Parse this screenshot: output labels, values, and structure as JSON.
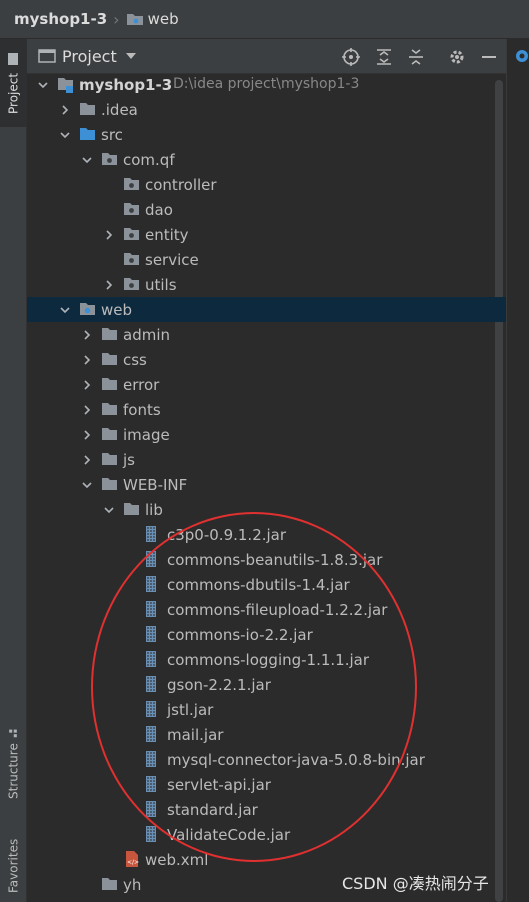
{
  "breadcrumb": {
    "project": "myshop1-3",
    "folder": "web"
  },
  "left_stripe": {
    "project_tab": "Project",
    "structure_tab": "Structure",
    "favorites_tab": "Favorites"
  },
  "panel": {
    "title": "Project"
  },
  "tree": [
    {
      "label": "myshop1-3",
      "path": "D:\\idea project\\myshop1-3",
      "depth": 0,
      "arrow": "down",
      "icon": "module",
      "bold": true
    },
    {
      "label": ".idea",
      "depth": 1,
      "arrow": "right",
      "icon": "folder"
    },
    {
      "label": "src",
      "depth": 1,
      "arrow": "down",
      "icon": "source-folder"
    },
    {
      "label": "com.qf",
      "depth": 2,
      "arrow": "down",
      "icon": "package"
    },
    {
      "label": "controller",
      "depth": 3,
      "arrow": "none",
      "icon": "package"
    },
    {
      "label": "dao",
      "depth": 3,
      "arrow": "none",
      "icon": "package"
    },
    {
      "label": "entity",
      "depth": 3,
      "arrow": "right",
      "icon": "package"
    },
    {
      "label": "service",
      "depth": 3,
      "arrow": "none",
      "icon": "package"
    },
    {
      "label": "utils",
      "depth": 3,
      "arrow": "right",
      "icon": "package"
    },
    {
      "label": "web",
      "depth": 1,
      "arrow": "down",
      "icon": "web-folder",
      "selected": true
    },
    {
      "label": "admin",
      "depth": 2,
      "arrow": "right",
      "icon": "folder"
    },
    {
      "label": "css",
      "depth": 2,
      "arrow": "right",
      "icon": "folder"
    },
    {
      "label": "error",
      "depth": 2,
      "arrow": "right",
      "icon": "folder"
    },
    {
      "label": "fonts",
      "depth": 2,
      "arrow": "right",
      "icon": "folder"
    },
    {
      "label": "image",
      "depth": 2,
      "arrow": "right",
      "icon": "folder"
    },
    {
      "label": "js",
      "depth": 2,
      "arrow": "right",
      "icon": "folder"
    },
    {
      "label": "WEB-INF",
      "depth": 2,
      "arrow": "down",
      "icon": "folder"
    },
    {
      "label": "lib",
      "depth": 3,
      "arrow": "down",
      "icon": "folder"
    },
    {
      "label": "c3p0-0.9.1.2.jar",
      "depth": 4,
      "arrow": "none",
      "icon": "jar"
    },
    {
      "label": "commons-beanutils-1.8.3.jar",
      "depth": 4,
      "arrow": "none",
      "icon": "jar"
    },
    {
      "label": "commons-dbutils-1.4.jar",
      "depth": 4,
      "arrow": "none",
      "icon": "jar"
    },
    {
      "label": "commons-fileupload-1.2.2.jar",
      "depth": 4,
      "arrow": "none",
      "icon": "jar"
    },
    {
      "label": "commons-io-2.2.jar",
      "depth": 4,
      "arrow": "none",
      "icon": "jar"
    },
    {
      "label": "commons-logging-1.1.1.jar",
      "depth": 4,
      "arrow": "none",
      "icon": "jar"
    },
    {
      "label": "gson-2.2.1.jar",
      "depth": 4,
      "arrow": "none",
      "icon": "jar"
    },
    {
      "label": "jstl.jar",
      "depth": 4,
      "arrow": "none",
      "icon": "jar"
    },
    {
      "label": "mail.jar",
      "depth": 4,
      "arrow": "none",
      "icon": "jar"
    },
    {
      "label": "mysql-connector-java-5.0.8-bin.jar",
      "depth": 4,
      "arrow": "none",
      "icon": "jar"
    },
    {
      "label": "servlet-api.jar",
      "depth": 4,
      "arrow": "none",
      "icon": "jar"
    },
    {
      "label": "standard.jar",
      "depth": 4,
      "arrow": "none",
      "icon": "jar"
    },
    {
      "label": "ValidateCode.jar",
      "depth": 4,
      "arrow": "none",
      "icon": "jar"
    },
    {
      "label": "web.xml",
      "depth": 3,
      "arrow": "none",
      "icon": "xml"
    },
    {
      "label": "yh",
      "depth": 2,
      "arrow": "none",
      "icon": "folder"
    }
  ],
  "watermark": "CSDN @凑热闹分子",
  "colors": {
    "background": "#2b2b2b",
    "panel": "#3c3f41",
    "selection": "#0d293e",
    "folder": "#8b9299",
    "source-folder": "#3d8fd6",
    "annotation": "#e03030"
  }
}
